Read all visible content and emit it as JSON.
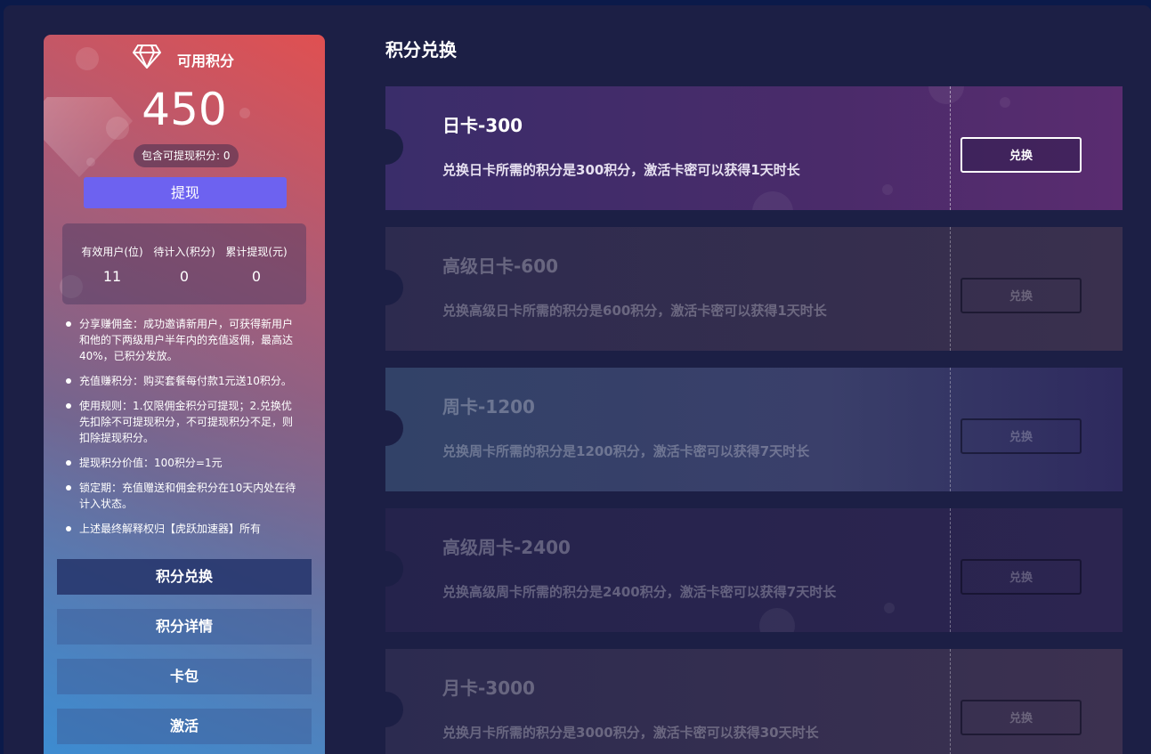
{
  "points_panel": {
    "title": "可用积分",
    "balance": "450",
    "withdrawable_label": "包含可提现积分: 0",
    "withdraw_button": "提现",
    "stats": [
      {
        "label": "有效用户(位)",
        "value": "11"
      },
      {
        "label": "待计入(积分)",
        "value": "0"
      },
      {
        "label": "累计提现(元)",
        "value": "0"
      }
    ],
    "rules": [
      "分享赚佣金：成功邀请新用户，可获得新用户和他的下两级用户半年内的充值返佣，最高达40%，已积分发放。",
      "充值赚积分：购买套餐每付款1元送10积分。",
      "使用规则：1.仅限佣金积分可提现；2.兑换优先扣除不可提现积分，不可提现积分不足，则扣除提现积分。",
      "提现积分价值：100积分=1元",
      "锁定期：充值赠送和佣金积分在10天内处在待计入状态。",
      "上述最终解释权归【虎跃加速器】所有"
    ],
    "menu": [
      "积分兑换",
      "积分详情",
      "卡包",
      "激活"
    ]
  },
  "exchange": {
    "title": "积分兑换",
    "cards": [
      {
        "name": "日卡-300",
        "desc": "兑换日卡所需的积分是300积分，激活卡密可以获得1天时长",
        "button": "兑换"
      },
      {
        "name": "高级日卡-600",
        "desc": "兑换高级日卡所需的积分是600积分，激活卡密可以获得1天时长",
        "button": "兑换"
      },
      {
        "name": "周卡-1200",
        "desc": "兑换周卡所需的积分是1200积分，激活卡密可以获得7天时长",
        "button": "兑换"
      },
      {
        "name": "高级周卡-2400",
        "desc": "兑换高级周卡所需的积分是2400积分，激活卡密可以获得7天时长",
        "button": "兑换"
      },
      {
        "name": "月卡-3000",
        "desc": "兑换月卡所需的积分是3000积分，激活卡密可以获得30天时长",
        "button": "兑换"
      }
    ]
  },
  "colors": {
    "accent_button": "#6d62f0",
    "page_bg": "#1c1f45"
  }
}
